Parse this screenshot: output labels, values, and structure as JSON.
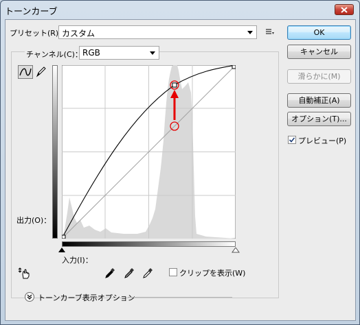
{
  "window": {
    "title": "トーンカーブ"
  },
  "preset": {
    "label": "プリセット(R)：",
    "value": "カスタム"
  },
  "channel": {
    "label": "チャンネル(C)：",
    "value": "RGB"
  },
  "buttons": {
    "ok": "OK",
    "cancel": "キャンセル",
    "smooth": "滑らかに(M)",
    "auto": "自動補正(A)",
    "options": "オプション(T)..."
  },
  "preview": {
    "label": "プレビュー(P)",
    "checked": true
  },
  "graph": {
    "output_label": "出力(O)：",
    "input_label": "入力(I)：",
    "grid_divisions": 4,
    "curve_color": "#000000",
    "histogram_color": "#d9d9d9",
    "annotation_color": "#e60000"
  },
  "clipping": {
    "label": "クリップを表示(W)",
    "checked": false
  },
  "display_options": {
    "label": "トーンカーブ表示オプション"
  },
  "icons": {
    "curve_tool": "curve-tool-icon",
    "pencil_tool": "pencil-icon",
    "target_adjust": "hand-adjust-icon",
    "eyedroppers": [
      "black-eyedropper-icon",
      "gray-eyedropper-icon",
      "white-eyedropper-icon"
    ],
    "preset_menu": "preset-menu-icon",
    "close": "close-icon"
  }
}
